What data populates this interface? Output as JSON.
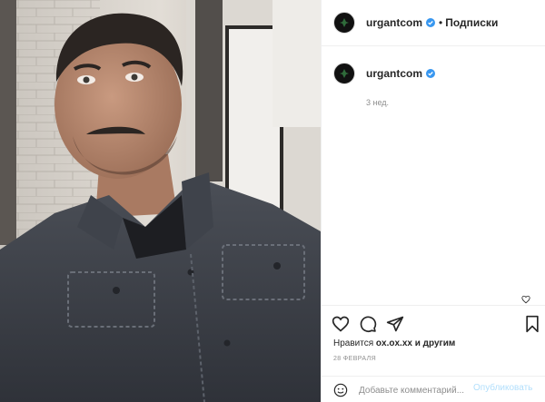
{
  "post": {
    "username": "urgantcom",
    "separator": "•",
    "follow_label": "Подписки",
    "time_ago": "3 нед.",
    "likes_prefix": "Нравится",
    "likes_user": "ox.ox.xx",
    "likes_suffix": "и другим",
    "date": "28 ФЕВРАЛЯ"
  },
  "comment": {
    "placeholder": "Добавьте комментарий...",
    "publish_label": "Опубликовать"
  },
  "colors": {
    "verified_badge": "#3897f0",
    "publish_disabled": "#b2dffc",
    "secondary_text": "#8e8e8e"
  },
  "icons": {
    "header_avatar": "avatar-logo-icon",
    "verified": "verified-badge-icon",
    "like": "heart-icon",
    "comment": "comment-icon",
    "share": "paper-plane-icon",
    "save": "bookmark-icon",
    "emoji": "smile-icon"
  }
}
